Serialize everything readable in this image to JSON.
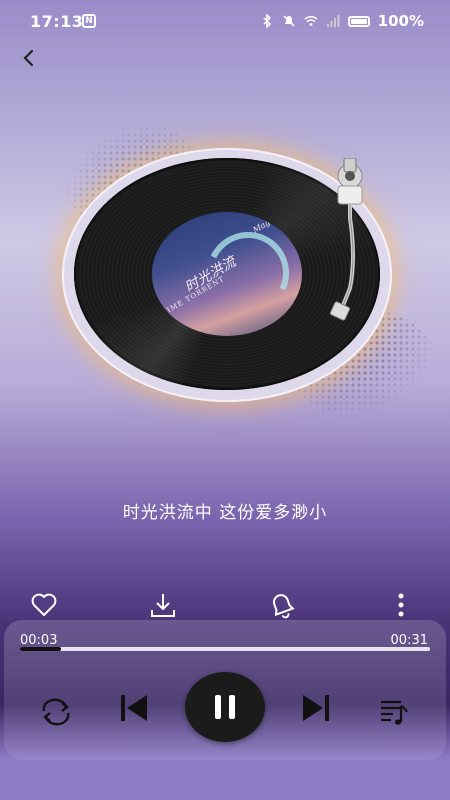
{
  "status_bar": {
    "time": "17:13",
    "nfc_label": "N",
    "battery_percent": "100%",
    "icons": [
      "nfc-icon",
      "bluetooth-icon",
      "mute-icon",
      "wifi-icon",
      "signal-icon",
      "battery-icon"
    ]
  },
  "album": {
    "label_title": "时光洪流",
    "label_subtitle": "TIME TORRENT",
    "label_signature": "Magic"
  },
  "lyric": {
    "current_line": "时光洪流中 这份爱多渺小"
  },
  "player": {
    "elapsed": "00:03",
    "total": "00:31",
    "progress_fraction": 0.1,
    "state": "playing"
  },
  "actions": [
    "heart-icon",
    "download-icon",
    "bell-icon",
    "more-vertical-icon"
  ],
  "controls": [
    "repeat-icon",
    "previous-icon",
    "pause-icon",
    "next-icon",
    "playlist-icon"
  ],
  "colors": {
    "accent_glow": "#ffbe5a",
    "play_button": "#1b1b1b",
    "progress_fill": "#111111"
  }
}
